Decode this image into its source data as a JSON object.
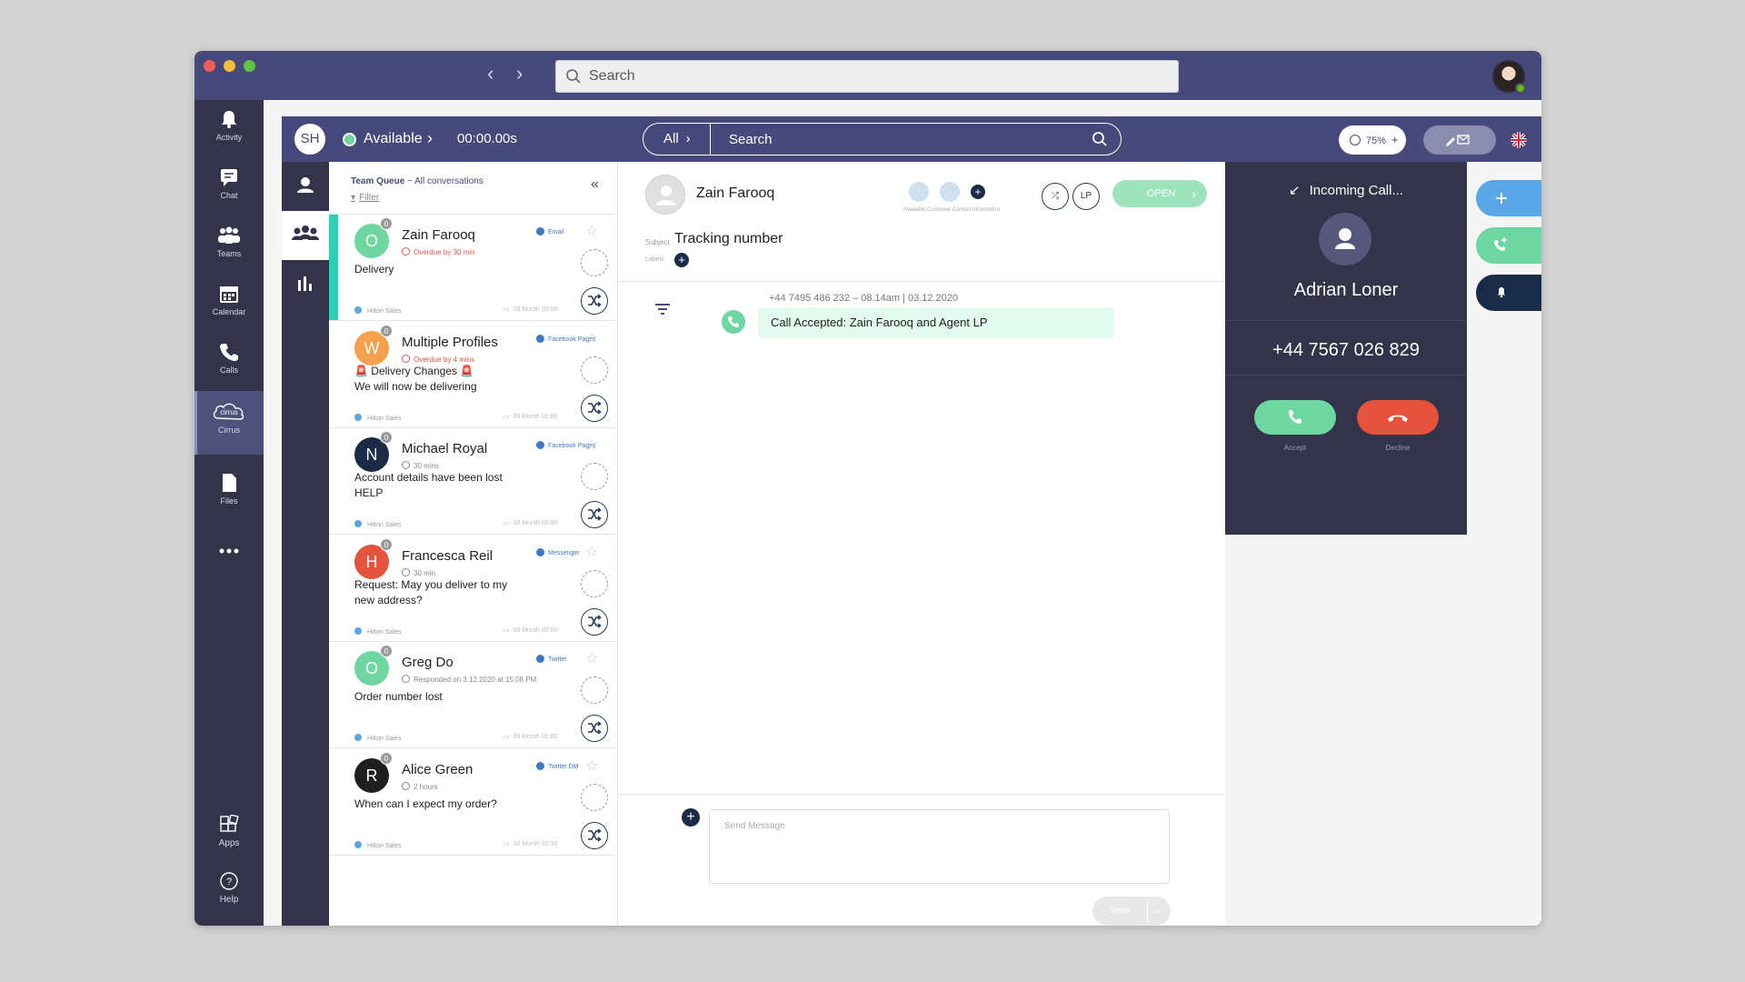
{
  "browser": {
    "search_placeholder": "Search"
  },
  "rail": {
    "items": [
      {
        "label": "Activity",
        "icon": "bell-icon"
      },
      {
        "label": "Chat",
        "icon": "chat-icon"
      },
      {
        "label": "Teams",
        "icon": "teams-icon"
      },
      {
        "label": "Calendar",
        "icon": "calendar-icon"
      },
      {
        "label": "Calls",
        "icon": "phone-icon"
      },
      {
        "label": "Cirrus",
        "icon": "cirrus-icon"
      },
      {
        "label": "Files",
        "icon": "file-icon"
      },
      {
        "label": "Apps",
        "icon": "apps-icon"
      },
      {
        "label": "Help",
        "icon": "help-icon"
      }
    ]
  },
  "header": {
    "initials": "SH",
    "status": "Available",
    "timer": "00:00.00s",
    "search_scope": "All",
    "search_placeholder": "Search",
    "capacity": "75%",
    "brand": "cirrus"
  },
  "queue": {
    "title": "Team Queue",
    "subtitle": " ~ All conversations",
    "filter": "Filter",
    "items": [
      {
        "initial": "O",
        "count": "0",
        "name": "Zain Farooq",
        "sub": "Overdue by 30 min",
        "channel": "Email",
        "message": "Delivery",
        "team": "Hilton Sales",
        "date": "00 Month 00:00",
        "color": "#6dd6a1"
      },
      {
        "initial": "W",
        "count": "0",
        "name": "Multiple Profiles",
        "sub": "Overdue by 4 mins",
        "channel": "Facebook Pages",
        "message": "🚨 Delivery Changes 🚨\nWe will now be delivering",
        "team": "Hilton Sales",
        "date": "00 Month 00:00",
        "color": "#f5a04c"
      },
      {
        "initial": "N",
        "count": "0",
        "name": "Michael Royal",
        "sub": "30 mins",
        "channel": "Facebook Pages",
        "message": "Account details have been lost HELP",
        "team": "Hilton Sales",
        "date": "00 Month 00:00",
        "color": "#1a2b48"
      },
      {
        "initial": "H",
        "count": "0",
        "name": "Francesca Reil",
        "sub": "30 min",
        "channel": "Messenger",
        "message": "Request: May you deliver to my new address?",
        "team": "Hilton Sales",
        "date": "00 Month 00:00",
        "color": "#e5533d"
      },
      {
        "initial": "O",
        "count": "0",
        "name": "Greg Do",
        "sub": "Responded on 3.12.2020 at 15:08 PM",
        "channel": "Twitter",
        "message": "Order number lost",
        "team": "Hilton Sales",
        "date": "00 Month 00:00",
        "color": "#6dd6a1"
      },
      {
        "initial": "R",
        "count": "0",
        "name": "Alice Green",
        "sub": "2 hours",
        "channel": "Twitter DM",
        "message": "When can I expect my order?",
        "team": "Hilton Sales",
        "date": "00 Month 00:00",
        "color": "#1f1f1f"
      }
    ]
  },
  "conversation": {
    "name": "Zain Farooq",
    "contact_info": "Available Customer Contact Information",
    "assignee": "LP",
    "status_button": "OPEN",
    "subject_label": "Subject",
    "subject": "Tracking number",
    "labels_label": "Labels",
    "event_meta": "+44 7495 486 232 – 08.14am | 03.12.2020",
    "event_text": "Call Accepted: Zain Farooq and Agent LP",
    "compose_placeholder": "Send Message",
    "send_label": "Send"
  },
  "call": {
    "title": "Incoming Call...",
    "caller": "Adrian Loner",
    "number": "+44 7567 026 829",
    "accept_label": "Accept",
    "decline_label": "Decline"
  },
  "colors": {
    "header": "#46497a",
    "rail": "#33344a",
    "accent_green": "#6dd6a1",
    "decline_red": "#e5533d",
    "selected_bar": "#2ad1b4"
  }
}
